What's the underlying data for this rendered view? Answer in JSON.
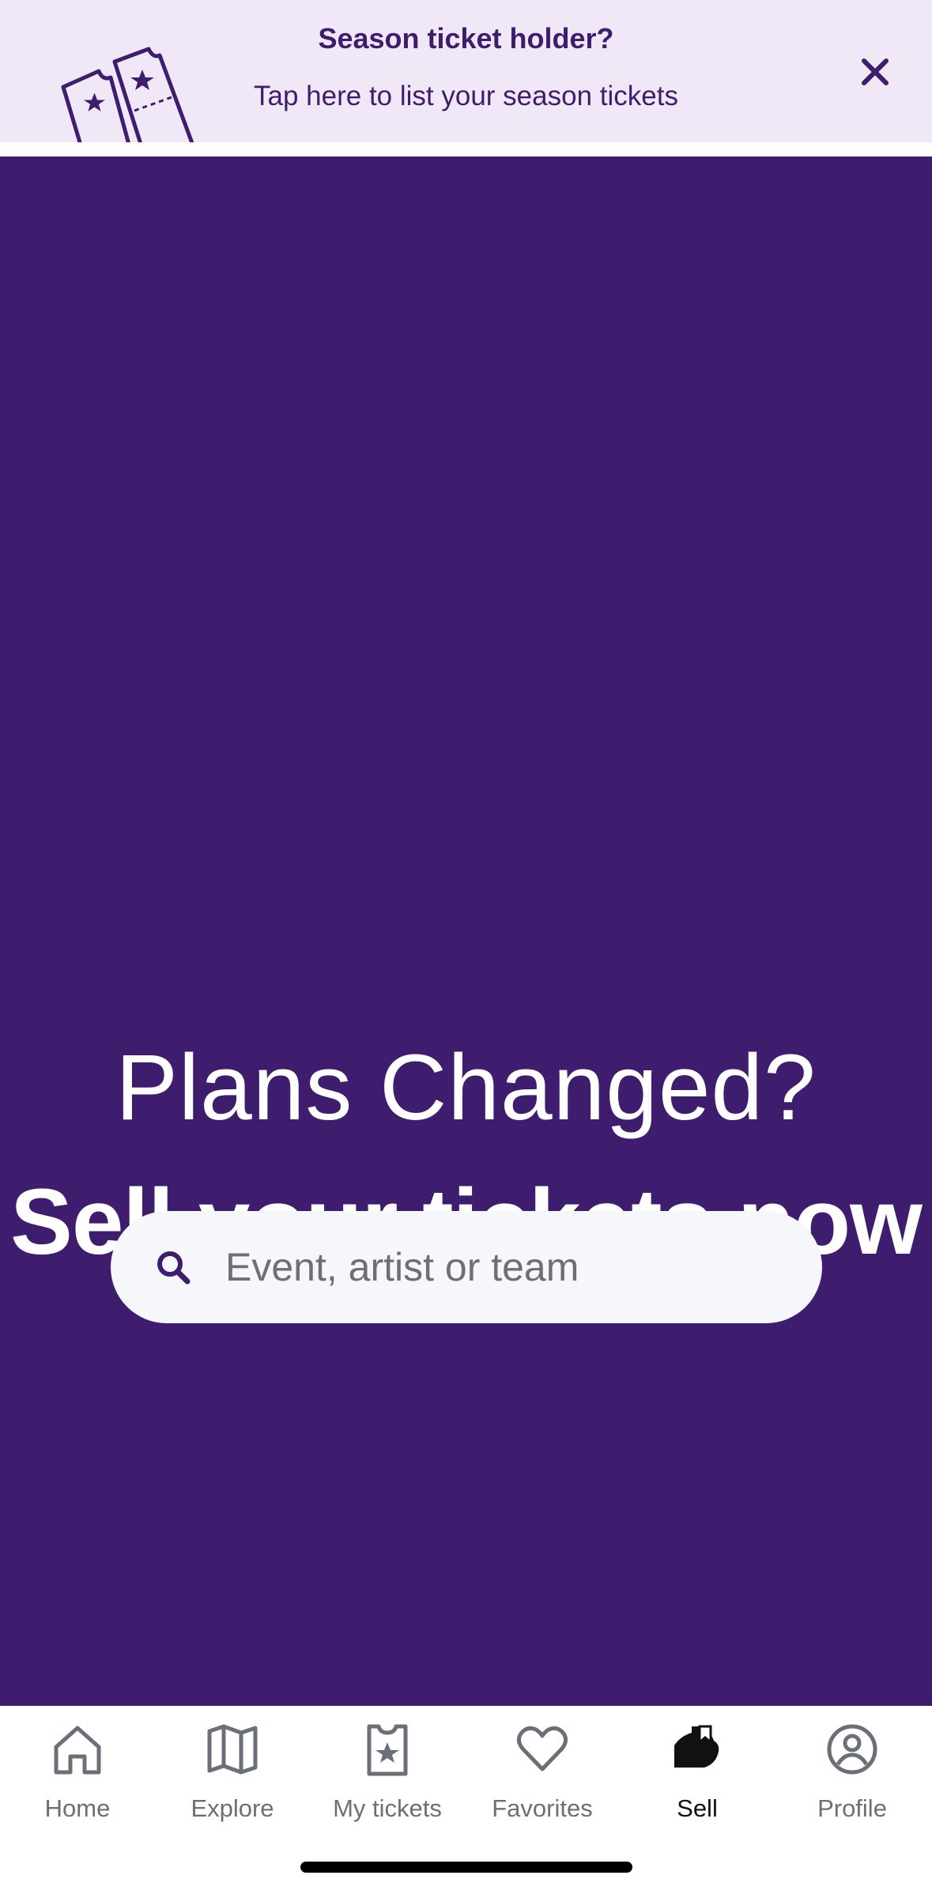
{
  "banner": {
    "title": "Season ticket holder?",
    "subtitle": "Tap here to list your season tickets",
    "close_icon": "close-icon",
    "art_icon": "tickets-illustration"
  },
  "hero": {
    "line1": "Plans Changed?",
    "line2": "Sell your tickets now",
    "background_color": "#3f1d6e"
  },
  "search": {
    "placeholder": "Event, artist or team",
    "value": "",
    "icon": "search-icon"
  },
  "tabbar": {
    "active": "Sell",
    "items": [
      {
        "label": "Home",
        "icon": "home-icon"
      },
      {
        "label": "Explore",
        "icon": "map-icon"
      },
      {
        "label": "My tickets",
        "icon": "ticket-star-icon"
      },
      {
        "label": "Favorites",
        "icon": "heart-icon"
      },
      {
        "label": "Sell",
        "icon": "sell-ticket-icon"
      },
      {
        "label": "Profile",
        "icon": "profile-icon"
      }
    ]
  },
  "colors": {
    "brand_purple": "#3f1d6e",
    "banner_bg": "#f0e8f7",
    "search_bg": "#f5f7fa",
    "tab_inactive": "#6b6f78",
    "tab_active": "#111111"
  }
}
